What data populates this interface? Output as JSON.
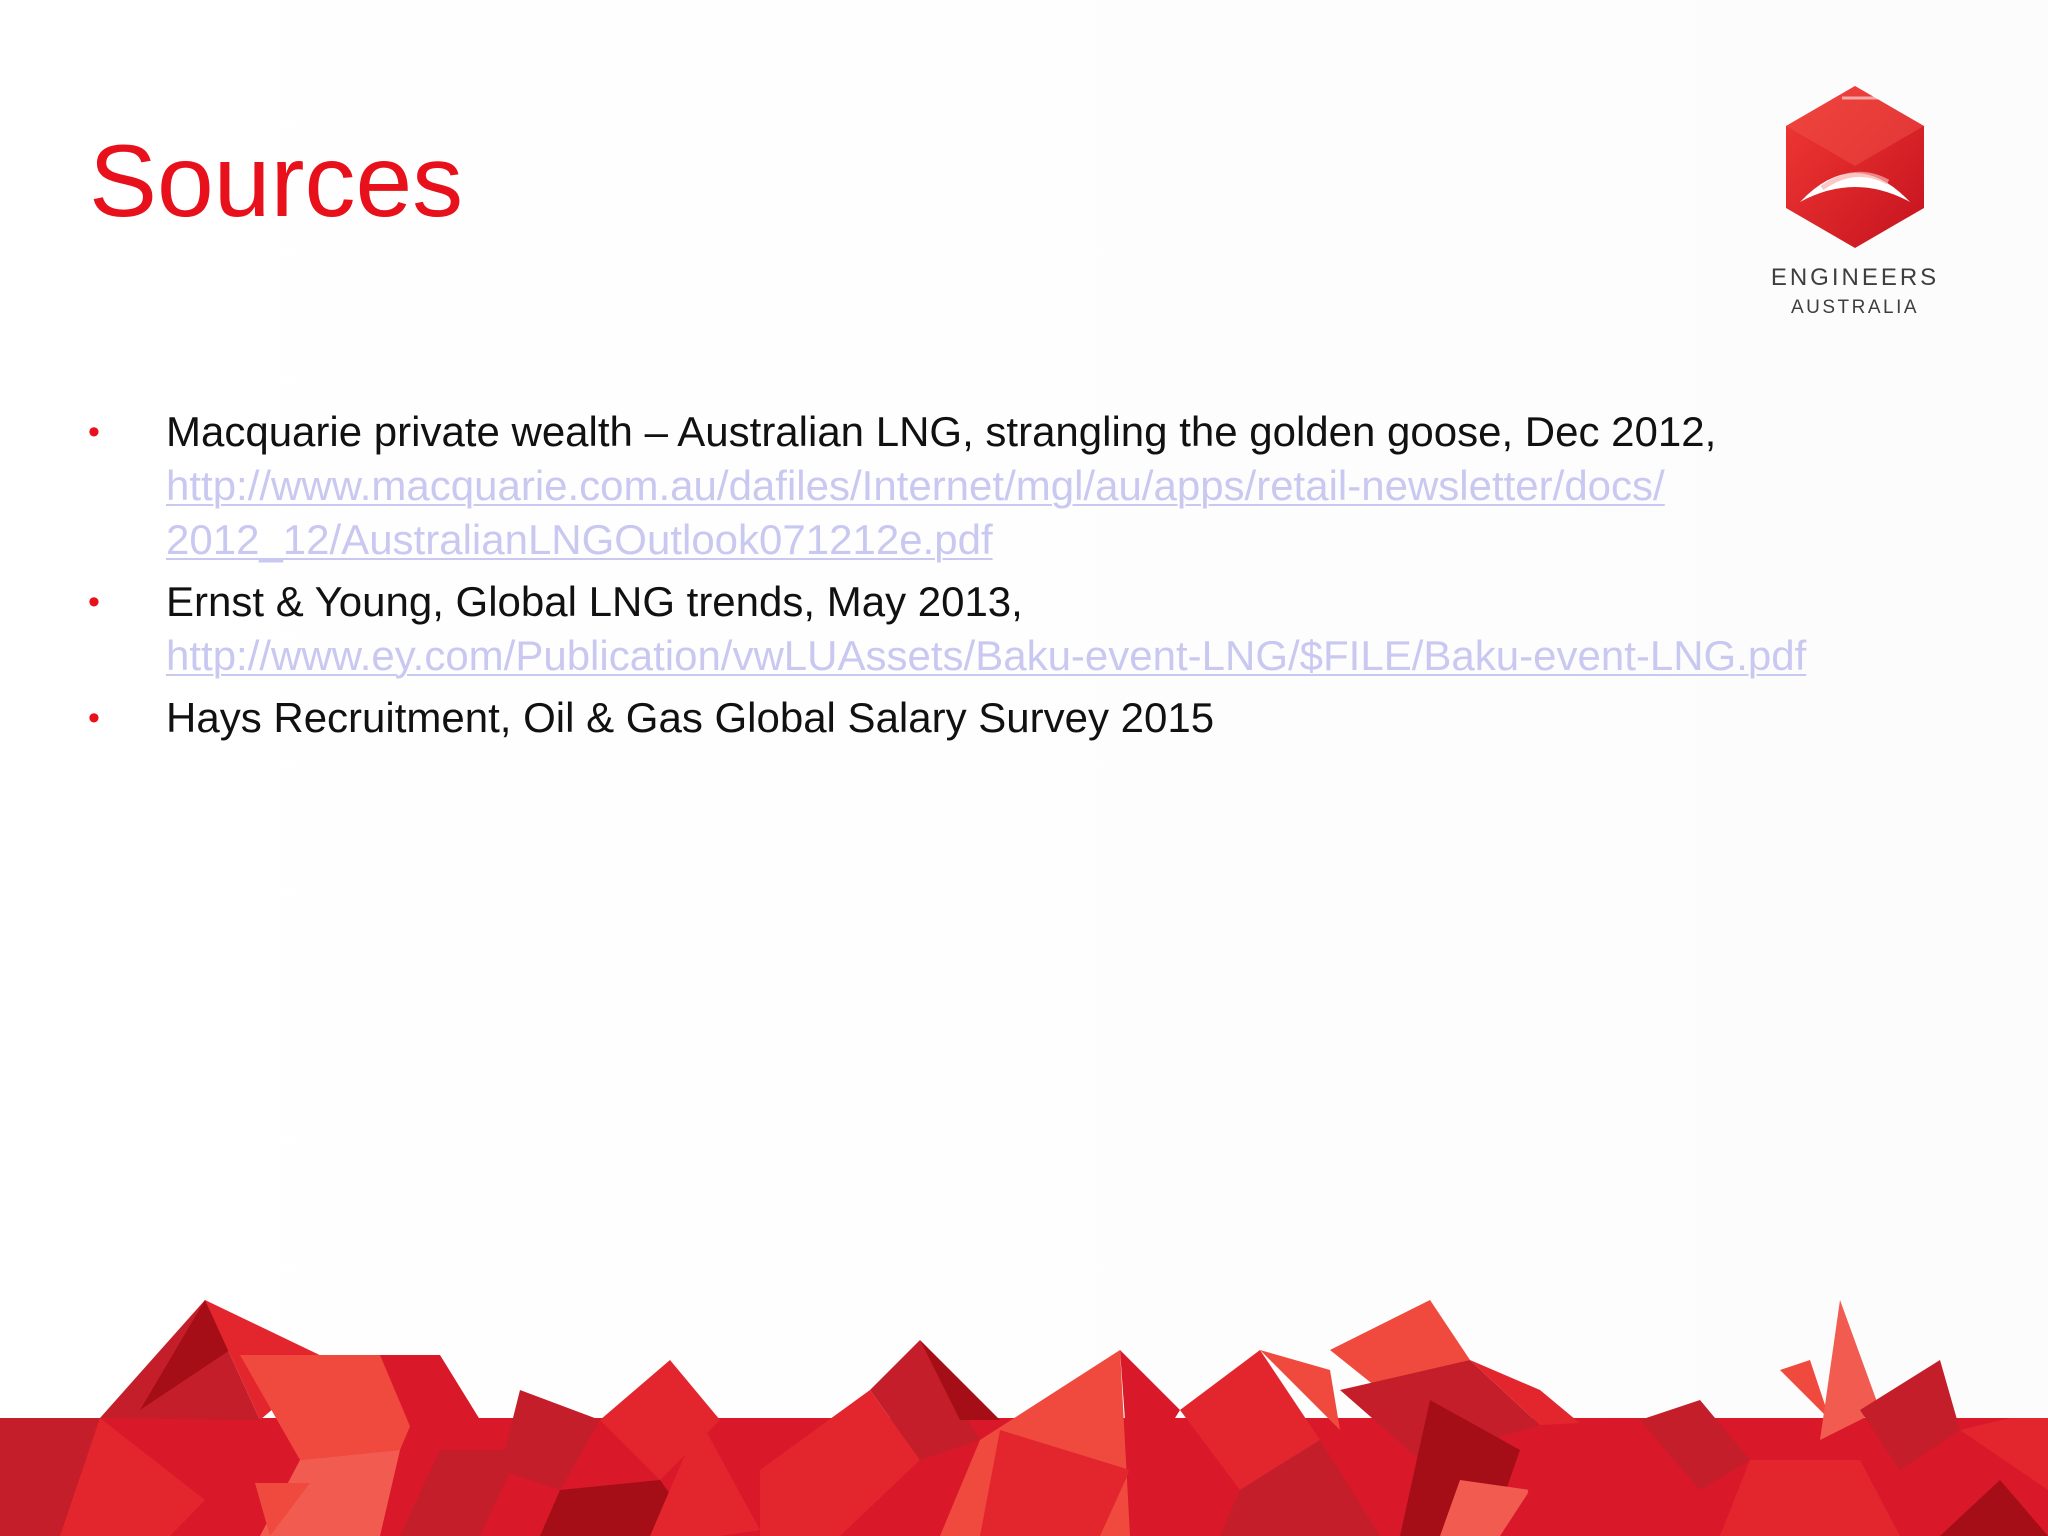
{
  "slide": {
    "title": "Sources",
    "logo": {
      "line1": "ENGINEERS",
      "line2": "AUSTRALIA",
      "name": "engineers-australia-logo"
    },
    "sources": [
      {
        "text": "Macquarie private wealth – Australian LNG, strangling the golden goose, Dec 2012,",
        "link_lines": [
          "http://www.macquarie.com.au/dafiles/Internet/mgl/au/apps/retail-newsletter/docs/",
          "2012_12/AustralianLNGOutlook071212e.pdf"
        ]
      },
      {
        "text": "Ernst & Young, Global LNG trends, May 2013,",
        "link_lines": [
          "http://www.ey.com/Publication/vwLUAssets/Baku-event-LNG/$FILE/Baku-event-LNG.pdf"
        ]
      },
      {
        "text": "Hays Recruitment, Oil & Gas Global Salary Survey 2015",
        "link_lines": []
      }
    ],
    "bullet_symbol": "•"
  },
  "colors": {
    "title_red": "#e8101a",
    "link": "#c9c8f0",
    "text": "#111111",
    "logo_text": "#3e3e40",
    "decor_reds": [
      "#c41e2a",
      "#e3262e",
      "#f04a3e",
      "#a50e16",
      "#f25c50",
      "#d9182a"
    ]
  }
}
